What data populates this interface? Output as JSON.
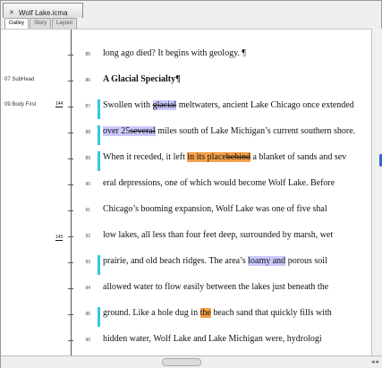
{
  "window": {
    "title": "Wolf Lake.icma",
    "tabs": [
      "Galley",
      "Story",
      "Layout"
    ]
  },
  "gutter": {
    "style_labels": [
      "07 SubHead",
      "09 Body First"
    ],
    "depth_marks": [
      "144",
      "145"
    ],
    "line_numbers": [
      "85",
      "86",
      "87",
      "88",
      "89",
      "90",
      "91",
      "92",
      "93",
      "94",
      "95",
      "96"
    ]
  },
  "document": {
    "lines": {
      "l85": "long ago died? It begins with geology. ¶",
      "l86": "A Glacial Specialty¶",
      "l87_a": "Swollen with ",
      "l87_b": "glacial",
      "l87_c": " meltwaters, ancient Lake Chicago once extended",
      "l88_a": "over 25",
      "l88_b": "several",
      "l88_c": " miles south of Lake Michigan’s current southern shore.",
      "l89_a": "When it receded, it left ",
      "l89_b": "in its place",
      "l89_c": "behind",
      "l89_d": " a blanket of sands and sev",
      "l90": "eral depressions, one of which would become Wolf Lake. Before",
      "l91": "Chicago’s booming expansion, Wolf Lake was one of five shal",
      "l92": "low lakes, all less than four feet deep, surrounded by marsh, wet",
      "l93_a": "prairie, and old beach ridges. The area’s ",
      "l93_b": "loamy and",
      "l93_c": " porous soil",
      "l94": "allowed water to flow easily between the lakes just beneath the",
      "l95_a": "ground. Like a hole dug in ",
      "l95_b": "the",
      "l95_c": " beach sand that quickly fills with",
      "l96": "hidden water, Wolf Lake and Lake Michigan were, hydrologi"
    }
  },
  "colors": {
    "change_bar": "#33c8e6",
    "highlight_purple": "#c9c9ff",
    "highlight_orange": "#f5a04a",
    "scroll_marker": "#2e68c9"
  }
}
